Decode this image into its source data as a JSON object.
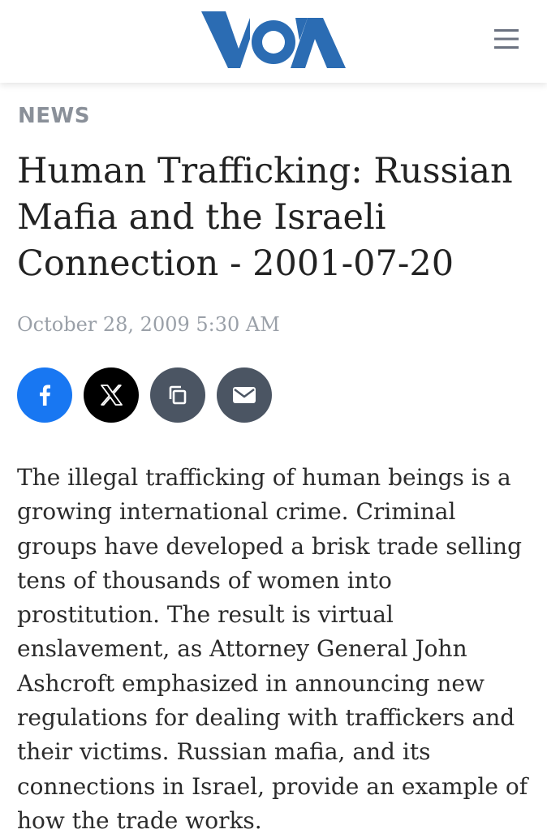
{
  "header": {
    "logo_text": "VOA",
    "brand_color": "#2b6cb3",
    "menu_icon": "hamburger-icon"
  },
  "article": {
    "category": "NEWS",
    "title": "Human Trafficking: Russian Mafia and the Israeli Connection - 2001-07-20",
    "date": "October 28, 2009 5:30 AM",
    "body": "The illegal trafficking of human beings is a growing international crime. Criminal groups have developed a brisk trade selling tens of thousands of women into prostitution. The result is virtual enslavement, as Attorney General John Ashcroft emphasized in announcing new regulations for dealing with traffickers and their victims. Russian mafia, and its connections in Israel, provide an example of how the trade works."
  },
  "share": {
    "buttons": [
      {
        "icon": "facebook-icon",
        "color": "#1877f2"
      },
      {
        "icon": "x-icon",
        "color": "#000000"
      },
      {
        "icon": "copy-icon",
        "color": "#4b5563"
      },
      {
        "icon": "mail-icon",
        "color": "#4b5563"
      }
    ]
  },
  "colors": {
    "category_gray": "#8a9099",
    "title_text": "#222222",
    "date_gray": "#9aa0a8",
    "body_text": "#2b2b2b"
  }
}
